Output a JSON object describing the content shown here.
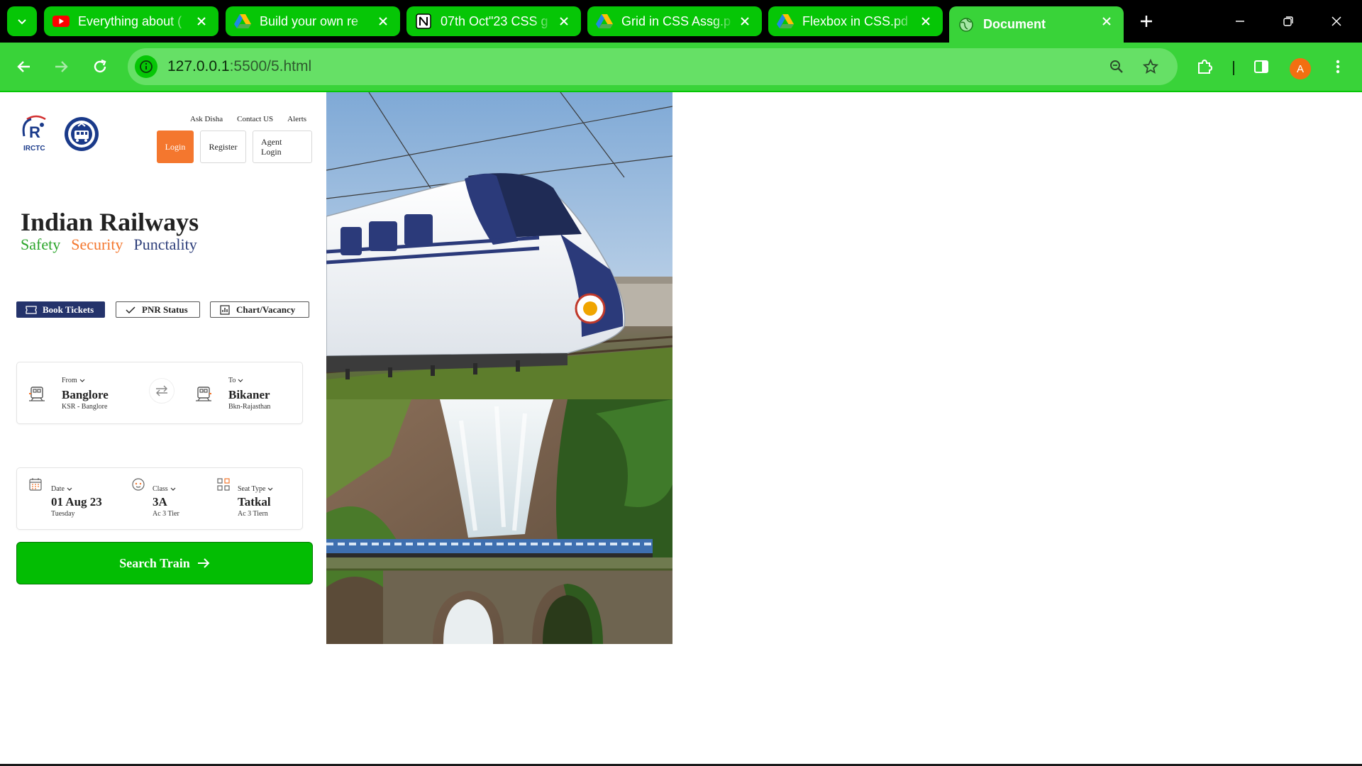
{
  "browser": {
    "tabs": [
      {
        "title": "Everything about (",
        "icon": "youtube-icon"
      },
      {
        "title": "Build your own re",
        "icon": "google-drive-icon"
      },
      {
        "title": "07th Oct\"23 CSS g",
        "icon": "notion-icon"
      },
      {
        "title": "Grid in CSS Assg.p",
        "icon": "google-drive-icon"
      },
      {
        "title": "Flexbox in CSS.pd",
        "icon": "google-drive-icon"
      },
      {
        "title": "Document",
        "icon": "globe-icon",
        "active": true
      }
    ],
    "url_host": "127.0.0.1",
    "url_path": ":5500/5.html",
    "profile_initial": "A",
    "accent_color": "#06c606"
  },
  "header": {
    "logo_text": "IRCTC",
    "links": [
      "Ask Disha",
      "Contact US",
      "Alerts"
    ],
    "login_label": "Login",
    "register_label": "Register",
    "agent_login_line1": "Agent",
    "agent_login_line2": "Login"
  },
  "hero": {
    "title": "Indian Railways",
    "tagline": [
      "Safety",
      "Security",
      "Punctality"
    ]
  },
  "modes": {
    "book": "Book Tickets",
    "pnr": "PNR Status",
    "chart": "Chart/Vacancy"
  },
  "route": {
    "from_label": "From",
    "from_value": "Banglore",
    "from_sub": "KSR - Banglore",
    "to_label": "To",
    "to_value": "Bikaner",
    "to_sub": "Bkn-Rajasthan"
  },
  "details": {
    "date_label": "Date",
    "date_value": "01 Aug 23",
    "date_sub": "Tuesday",
    "class_label": "Class",
    "class_value": "3A",
    "class_sub": "Ac 3 Tier",
    "seat_label": "Seat Type",
    "seat_value": "Tatkal",
    "seat_sub": "Ac 3 Tiern"
  },
  "search_button": "Search Train",
  "colors": {
    "orange": "#f4772e",
    "navy": "#24336b",
    "green": "#03bd03"
  }
}
